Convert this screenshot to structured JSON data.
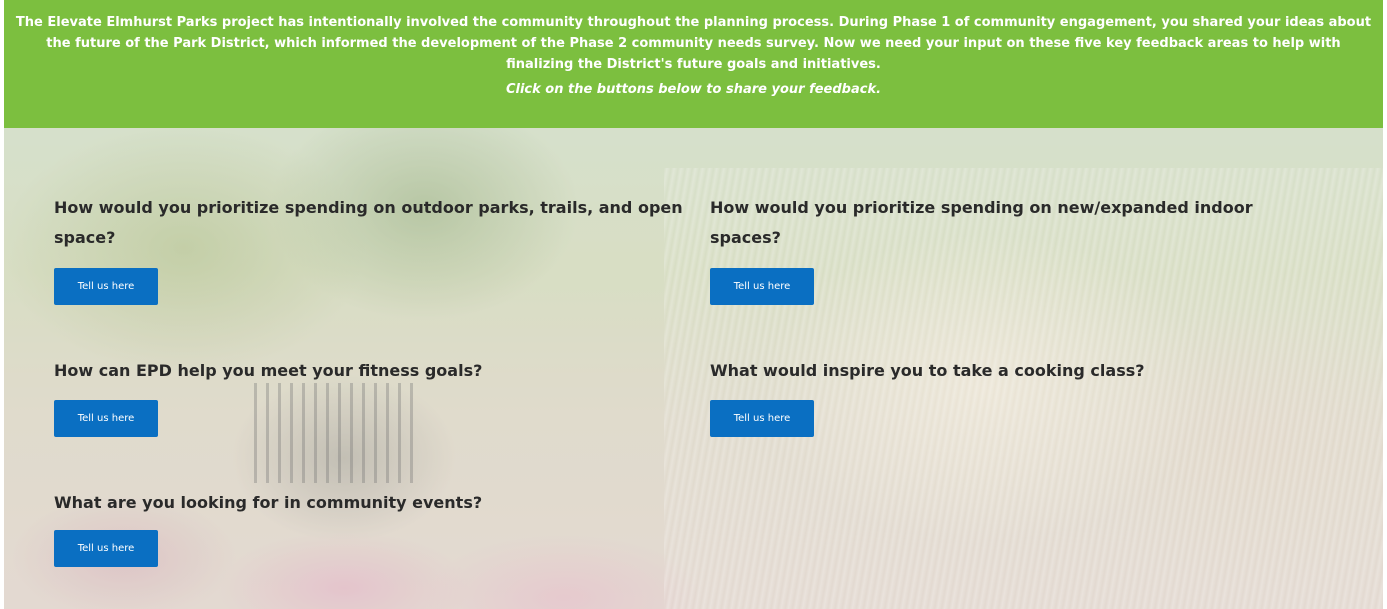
{
  "banner": {
    "text": "The Elevate Elmhurst Parks project has intentionally involved the community throughout the planning process. During Phase 1 of community engagement, you shared your ideas about the future of the Park District, which informed the development of the Phase 2 community needs survey. Now we need your input on these five key feedback areas to help with finalizing the District's future goals and initiatives.",
    "cta": "Click on the buttons below to share your feedback."
  },
  "colors": {
    "banner_bg": "#7cbf3f",
    "button_bg": "#0a6fc2",
    "heading_text": "#2a2a2a"
  },
  "items": [
    {
      "question": "How would you prioritize spending on outdoor parks, trails, and open space?",
      "button": "Tell us here"
    },
    {
      "question": "How would you prioritize spending on new/expanded indoor spaces?",
      "button": "Tell us here"
    },
    {
      "question": "How can EPD help you meet your fitness goals?",
      "button": "Tell us here"
    },
    {
      "question": "What would inspire you to take a cooking class?",
      "button": "Tell us here"
    },
    {
      "question": "What are you looking for in community events?",
      "button": "Tell us here"
    }
  ]
}
